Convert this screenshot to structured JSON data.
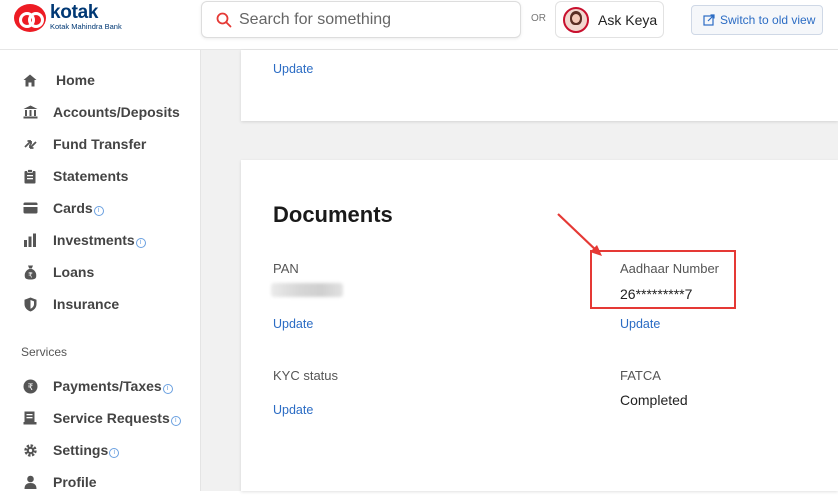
{
  "header": {
    "logo_name": "kotak",
    "logo_sub": "Kotak Mahindra Bank",
    "search_placeholder": "Search for something",
    "or_label": "OR",
    "ask_keya": "Ask Keya",
    "switch_old_view": "Switch to old view"
  },
  "sidebar": {
    "items": [
      {
        "label": "Home",
        "icon": "home-icon"
      },
      {
        "label": "Accounts/Deposits",
        "icon": "bank-icon"
      },
      {
        "label": "Fund Transfer",
        "icon": "transfer-icon"
      },
      {
        "label": "Statements",
        "icon": "clipboard-icon"
      },
      {
        "label": "Cards",
        "icon": "card-icon"
      },
      {
        "label": "Investments",
        "icon": "bar-chart-icon"
      },
      {
        "label": "Loans",
        "icon": "money-bag-icon"
      },
      {
        "label": "Insurance",
        "icon": "shield-icon"
      }
    ],
    "section_label": "Services",
    "services": [
      {
        "label": "Payments/Taxes",
        "icon": "rupee-icon"
      },
      {
        "label": "Service Requests",
        "icon": "ticket-icon"
      },
      {
        "label": "Settings",
        "icon": "gear-icon"
      },
      {
        "label": "Profile",
        "icon": "user-icon"
      }
    ],
    "info_glyph": "i"
  },
  "main": {
    "top_card": {
      "update_label": "Update"
    },
    "documents": {
      "title": "Documents",
      "pan_label": "PAN",
      "pan_update": "Update",
      "aadhaar_label": "Aadhaar Number",
      "aadhaar_value": "26*********7",
      "aadhaar_update": "Update",
      "kyc_label": "KYC status",
      "kyc_update": "Update",
      "fatca_label": "FATCA",
      "fatca_value": "Completed"
    }
  },
  "colors": {
    "accent": "#2b6cc4",
    "brand_red": "#ed1c24",
    "brand_navy": "#003874",
    "annotation_red": "#e53935"
  }
}
